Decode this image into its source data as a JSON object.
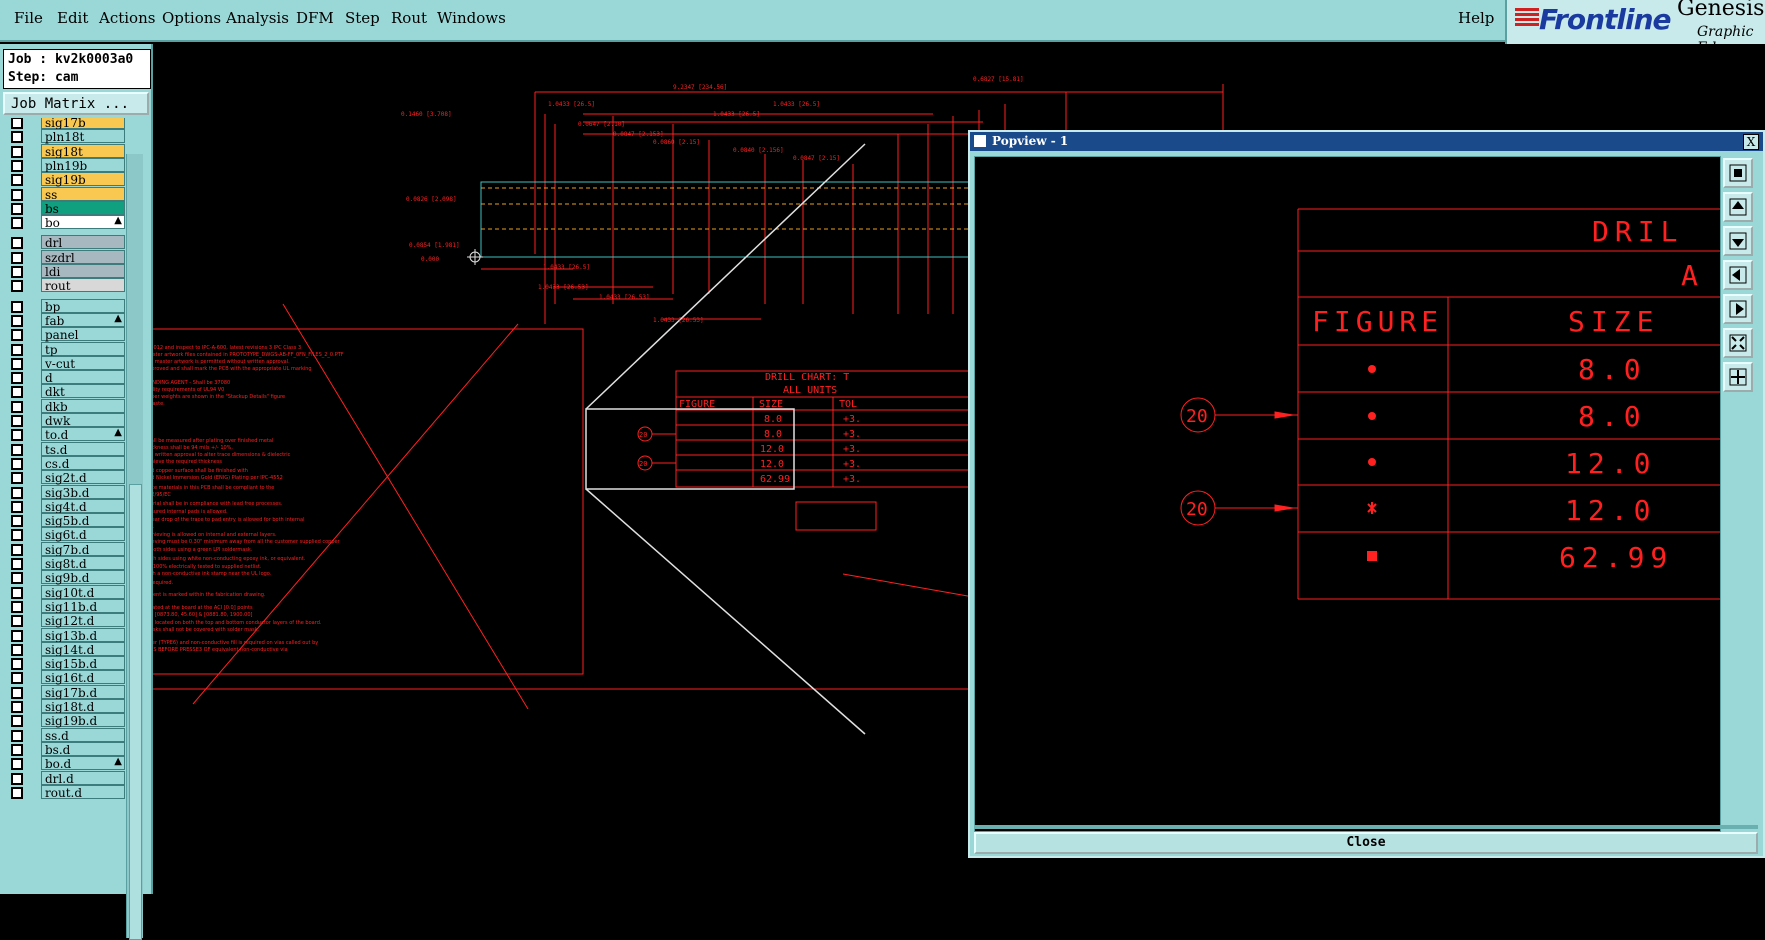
{
  "menubar": {
    "items": [
      "File",
      "Edit",
      "Actions",
      "Options",
      "Analysis",
      "DFM",
      "Step",
      "Rout",
      "Windows"
    ],
    "help": "Help"
  },
  "brand": {
    "logo": "Frontline",
    "product": "Genesis",
    "subtitle": "Graphic Ed"
  },
  "job": {
    "job_line": "Job : kv2k0003a0",
    "step_line": "Step: cam",
    "matrix_button": "Job Matrix ..."
  },
  "layers": [
    {
      "name": "sig17b",
      "color": "#f8c850",
      "mark": ""
    },
    {
      "name": "pln18t",
      "color": "#9ad8d8",
      "mark": ""
    },
    {
      "name": "sig18t",
      "color": "#f8c850",
      "mark": ""
    },
    {
      "name": "pln19b",
      "color": "#9ad8d8",
      "mark": ""
    },
    {
      "name": "sig19b",
      "color": "#f8c850",
      "mark": ""
    },
    {
      "name": "ss",
      "color": "#f8c850",
      "mark": ""
    },
    {
      "name": "bs",
      "color": "#10a080",
      "mark": ""
    },
    {
      "name": "bo",
      "color": "#ffffff",
      "mark": "▲"
    },
    {
      "name": "drl",
      "color": "#a8b8c0",
      "mark": ""
    },
    {
      "name": "szdrl",
      "color": "#a8b8c0",
      "mark": ""
    },
    {
      "name": "ldi",
      "color": "#a8b8c0",
      "mark": ""
    },
    {
      "name": "rout",
      "color": "#d8d8d8",
      "mark": ""
    },
    {
      "name": "bp",
      "color": "#9ad8d8",
      "mark": ""
    },
    {
      "name": "fab",
      "color": "#9ad8d8",
      "mark": "▲"
    },
    {
      "name": "panel",
      "color": "#9ad8d8",
      "mark": ""
    },
    {
      "name": "tp",
      "color": "#9ad8d8",
      "mark": ""
    },
    {
      "name": "v-cut",
      "color": "#9ad8d8",
      "mark": ""
    },
    {
      "name": "d",
      "color": "#9ad8d8",
      "mark": ""
    },
    {
      "name": "dkt",
      "color": "#9ad8d8",
      "mark": ""
    },
    {
      "name": "dkb",
      "color": "#9ad8d8",
      "mark": ""
    },
    {
      "name": "dwk",
      "color": "#9ad8d8",
      "mark": ""
    },
    {
      "name": "to.d",
      "color": "#9ad8d8",
      "mark": "▲"
    },
    {
      "name": "ts.d",
      "color": "#9ad8d8",
      "mark": ""
    },
    {
      "name": "cs.d",
      "color": "#9ad8d8",
      "mark": ""
    },
    {
      "name": "sig2t.d",
      "color": "#9ad8d8",
      "mark": ""
    },
    {
      "name": "sig3b.d",
      "color": "#9ad8d8",
      "mark": ""
    },
    {
      "name": "sig4t.d",
      "color": "#9ad8d8",
      "mark": ""
    },
    {
      "name": "sig5b.d",
      "color": "#9ad8d8",
      "mark": ""
    },
    {
      "name": "sig6t.d",
      "color": "#9ad8d8",
      "mark": ""
    },
    {
      "name": "sig7b.d",
      "color": "#9ad8d8",
      "mark": ""
    },
    {
      "name": "sig8t.d",
      "color": "#9ad8d8",
      "mark": ""
    },
    {
      "name": "sig9b.d",
      "color": "#9ad8d8",
      "mark": ""
    },
    {
      "name": "sig10t.d",
      "color": "#9ad8d8",
      "mark": ""
    },
    {
      "name": "sig11b.d",
      "color": "#9ad8d8",
      "mark": ""
    },
    {
      "name": "sig12t.d",
      "color": "#9ad8d8",
      "mark": ""
    },
    {
      "name": "sig13b.d",
      "color": "#9ad8d8",
      "mark": ""
    },
    {
      "name": "sig14t.d",
      "color": "#9ad8d8",
      "mark": ""
    },
    {
      "name": "sig15b.d",
      "color": "#9ad8d8",
      "mark": ""
    },
    {
      "name": "sig16t.d",
      "color": "#9ad8d8",
      "mark": ""
    },
    {
      "name": "sig17b.d",
      "color": "#9ad8d8",
      "mark": ""
    },
    {
      "name": "sig18t.d",
      "color": "#9ad8d8",
      "mark": ""
    },
    {
      "name": "sig19b.d",
      "color": "#9ad8d8",
      "mark": ""
    },
    {
      "name": "ss.d",
      "color": "#9ad8d8",
      "mark": ""
    },
    {
      "name": "bs.d",
      "color": "#9ad8d8",
      "mark": ""
    },
    {
      "name": "bo.d",
      "color": "#9ad8d8",
      "mark": "▲"
    },
    {
      "name": "drl.d",
      "color": "#9ad8d8",
      "mark": ""
    },
    {
      "name": "rout.d",
      "color": "#9ad8d8",
      "mark": ""
    }
  ],
  "drawing": {
    "top_dim": "9.2347 [234.56]",
    "right_dim": "0.6827 [15.81]",
    "chart_title": "DRILL CHART: T",
    "chart_units": "ALL UNITS",
    "col_figure": "FIGURE",
    "col_size": "SIZE",
    "col_tol": "TOL",
    "rows": [
      "8.0",
      "8.0",
      "12.0",
      "12.0",
      "62.99"
    ],
    "tol": [
      "+3.",
      "+3.",
      "+3.",
      "+3.",
      "+3."
    ],
    "callout": "20"
  },
  "popview": {
    "title": "Popview - 1",
    "close_x": "X",
    "close_button": "Close",
    "chart_title_fragment": "DRIL",
    "units_fragment": "A",
    "col_figure": "FIGURE",
    "col_size": "SIZE",
    "sizes": [
      "8.0",
      "8.0",
      "12.0",
      "12.0",
      "62.99"
    ],
    "callout": "20"
  },
  "colors": {
    "drawing": "#ff2020",
    "accent_teal": "#9ad8d8",
    "title_blue": "#1a4a8a"
  }
}
